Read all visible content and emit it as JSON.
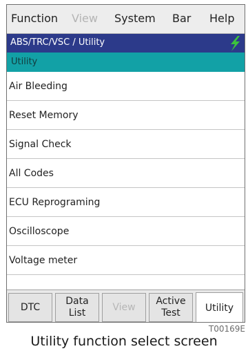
{
  "menubar": {
    "items": [
      {
        "label": "Function",
        "enabled": true
      },
      {
        "label": "View",
        "enabled": false
      },
      {
        "label": "System",
        "enabled": true
      },
      {
        "label": "Bar",
        "enabled": true
      },
      {
        "label": "Help",
        "enabled": true
      }
    ]
  },
  "path_bar": {
    "text": "ABS/TRC/VSC / Utility",
    "icon": "lightning-bolt-icon"
  },
  "section": {
    "title": "Utility"
  },
  "list": {
    "items": [
      "Air Bleeding",
      "Reset Memory",
      "Signal Check",
      "All Codes",
      "ECU Reprograming",
      "Oscilloscope",
      "Voltage meter"
    ]
  },
  "tabs": [
    {
      "label": "DTC",
      "enabled": true
    },
    {
      "label": "Data\nList",
      "enabled": true
    },
    {
      "label": "View",
      "enabled": false
    },
    {
      "label": "Active\nTest",
      "enabled": true
    },
    {
      "label": "Utility",
      "enabled": true,
      "selected": true
    }
  ],
  "figure": {
    "code": "T00169E",
    "caption": "Utility function select screen"
  },
  "colors": {
    "path_bar": "#2c3a8a",
    "section_bar": "#12a1a6",
    "bolt": "#3cc43c"
  }
}
